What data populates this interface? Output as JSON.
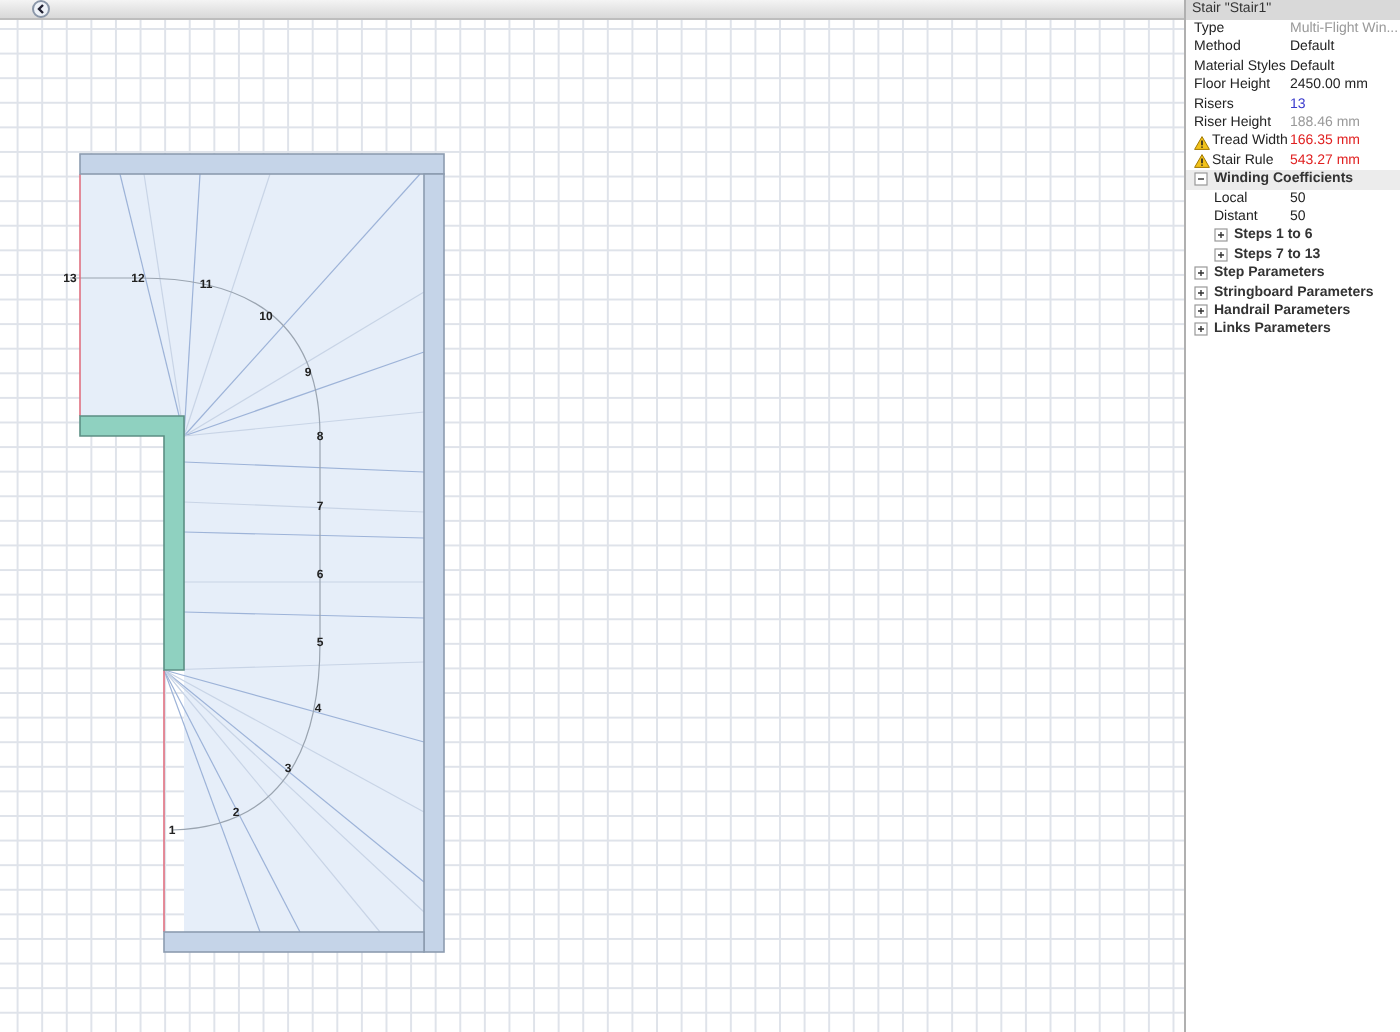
{
  "toolbar": {
    "collapse_button": {
      "pressed": false
    }
  },
  "canvas": {
    "step_numbers": [
      "13",
      "12",
      "11",
      "10",
      "9",
      "8",
      "7",
      "6",
      "5",
      "4",
      "3",
      "2",
      "1"
    ]
  },
  "properties": {
    "title": "Stair \"Stair1\"",
    "rows": [
      {
        "label": "Type",
        "value": "Multi-Flight Win...",
        "kind": "readonly",
        "warning": false
      },
      {
        "label": "Method",
        "value": "Default",
        "kind": "text",
        "warning": false
      },
      {
        "label": "Material Styles",
        "value": "Default",
        "kind": "text",
        "warning": false
      },
      {
        "label": "Floor Height",
        "value": "2450.00 mm",
        "kind": "text",
        "warning": false
      },
      {
        "label": "Risers",
        "value": "13",
        "kind": "number",
        "warning": false
      },
      {
        "label": "Riser Height",
        "value": "188.46 mm",
        "kind": "readonly",
        "warning": false
      },
      {
        "label": "Tread Width",
        "value": "166.35 mm",
        "kind": "error",
        "warning": true
      },
      {
        "label": "Stair Rule",
        "value": "543.27 mm",
        "kind": "error",
        "warning": true
      }
    ],
    "groups": [
      {
        "label": "Winding Coefficients",
        "expanded": true,
        "rows": [
          {
            "label": "Local",
            "value": "50"
          },
          {
            "label": "Distant",
            "value": "50"
          }
        ],
        "children": [
          {
            "label": "Steps 1 to 6",
            "expanded": false
          },
          {
            "label": "Steps 7 to 13",
            "expanded": false
          }
        ]
      },
      {
        "label": "Step Parameters",
        "expanded": false
      },
      {
        "label": "Stringboard Parameters",
        "expanded": false
      },
      {
        "label": "Handrail Parameters",
        "expanded": false
      },
      {
        "label": "Links Parameters",
        "expanded": false
      }
    ]
  }
}
